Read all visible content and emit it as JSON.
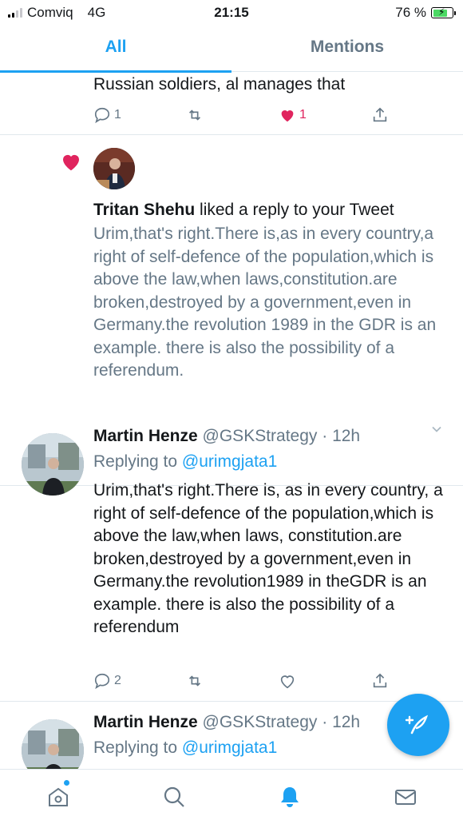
{
  "status_bar": {
    "carrier": "Comviq",
    "network": "4G",
    "time": "21:15",
    "battery": "76 %",
    "battery_level": 0.76
  },
  "tabs": [
    {
      "label": "All",
      "active": true
    },
    {
      "label": "Mentions",
      "active": false
    }
  ],
  "top_tweet": {
    "text": "Russian soldiers, al manages that",
    "reply_count": "1",
    "like_count": "1"
  },
  "notification": {
    "actor": "Tritan Shehu",
    "action_text": " liked a reply to your Tweet",
    "quoted_text": "Urim,that's right.There is,as in every country,a right of self-defence of the population,which is above the law,when laws,constitution.are broken,destroyed by a government,even in Germany.the revolution 1989 in the GDR is an example. there is also the possibility of a referendum."
  },
  "tweets": [
    {
      "name": "Martin Henze",
      "handle": "@GSKStrategy",
      "sep": " · ",
      "time": "12h",
      "replying_prefix": "Replying to ",
      "replying_to": "@urimgjata1",
      "text": "Urim,that's right.There is, as in every country, a right of self-defence of the population,which is above the law,when laws, constitution.are broken,destroyed by a government,even in Germany.the revolution1989 in theGDR is an example. there is also the possibility of a referendum",
      "reply_count": "2"
    },
    {
      "name": "Martin Henze",
      "handle": "@GSKStrategy",
      "sep": " · ",
      "time": "12h",
      "replying_prefix": "Replying to ",
      "replying_to": "@urimgjata1"
    }
  ],
  "icons": {
    "reply": "reply-icon",
    "retweet": "retweet-icon",
    "like": "heart-icon",
    "share": "share-icon",
    "compose": "compose-feather-icon",
    "nav": [
      "home-icon",
      "search-icon",
      "bell-icon",
      "mail-icon"
    ]
  },
  "colors": {
    "accent": "#1da1f2",
    "like": "#e0245e",
    "muted": "#657786"
  }
}
